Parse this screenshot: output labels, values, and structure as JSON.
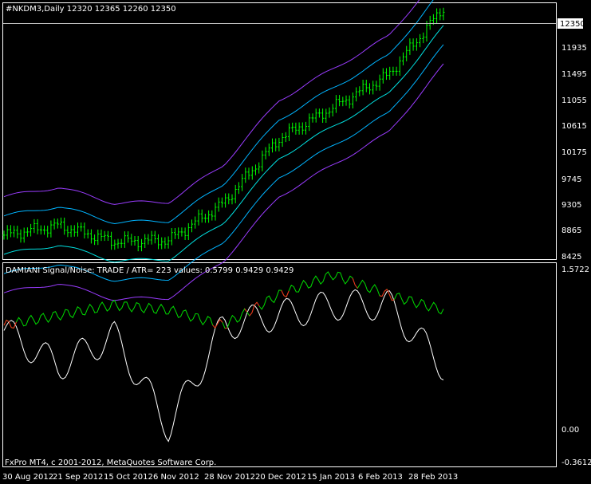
{
  "main_chart": {
    "header": "#NKDM3,Daily  12320 12365 12260 12350",
    "current_price": "12350",
    "y_ticks": [
      "11935",
      "11495",
      "11055",
      "10615",
      "10175",
      "9745",
      "9305",
      "8865",
      "8425"
    ],
    "colors": {
      "candles": "#00ff00",
      "band_outer": "#9a3cff",
      "band_inner": "#00b4ff",
      "band_mid": "#00e0e0",
      "axis": "#ffffff"
    }
  },
  "indicator": {
    "header": "DAMIANI Signal/Noise: TRADE  /  ATR= 223     values: 0.5799 0.9429 0.9429",
    "y_ticks": [
      "1.5722",
      "0.00",
      "-0.3612"
    ],
    "colors": {
      "signal": "#00dd00",
      "noise": "#ffffff",
      "trade": "#ff2020"
    }
  },
  "x_ticks": [
    "30 Aug 2012",
    "21 Sep 2012",
    "15 Oct 2012",
    "6 Nov 2012",
    "28 Nov 2012",
    "20 Dec 2012",
    "15 Jan 2013",
    "6 Feb 2013",
    "28 Feb 2013"
  ],
  "footer": "FxPro MT4, c 2001-2012, MetaQuotes Software Corp.",
  "chart_data": [
    {
      "type": "line",
      "title": "#NKDM3,Daily  12320 12365 12260 12350",
      "ylim": [
        8425,
        12420
      ],
      "x": [
        "30 Aug 2012",
        "21 Sep 2012",
        "15 Oct 2012",
        "6 Nov 2012",
        "28 Nov 2012",
        "20 Dec 2012",
        "15 Jan 2013",
        "6 Feb 2013",
        "28 Feb 2013"
      ],
      "series": [
        {
          "values": [
            8800,
            8950,
            8700,
            8720,
            9300,
            10300,
            10800,
            11300,
            12350
          ]
        }
      ]
    },
    {
      "type": "line",
      "title": "DAMIANI Signal/Noise: TRADE  /  ATR= 223     values: 0.5799 0.9429 0.9429",
      "ylim": [
        -0.3612,
        1.5722
      ],
      "x": [
        "30 Aug 2012",
        "21 Sep 2012",
        "15 Oct 2012",
        "6 Nov 2012",
        "28 Nov 2012",
        "20 Dec 2012",
        "15 Jan 2013",
        "6 Feb 2013",
        "28 Feb 2013"
      ],
      "series": [
        {
          "values": [
            1.0,
            1.1,
            1.2,
            1.15,
            1.0,
            1.3,
            1.5,
            1.3,
            1.15
          ]
        },
        {
          "values": [
            0.95,
            0.6,
            0.9,
            0.0,
            1.0,
            1.1,
            1.2,
            1.2,
            0.6
          ]
        }
      ]
    }
  ]
}
